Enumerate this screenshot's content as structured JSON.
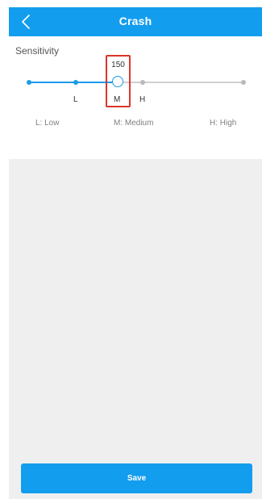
{
  "header": {
    "title": "Crash",
    "back_icon": "chevron-left-icon"
  },
  "sensitivity": {
    "label": "Sensitivity",
    "value": "150",
    "selected": "M",
    "levels": [
      "L",
      "M",
      "H"
    ],
    "legend": {
      "low": "L: Low",
      "medium": "M: Medium",
      "high": "H: High"
    }
  },
  "footer": {
    "save_label": "Save"
  },
  "colors": {
    "accent": "#139dee",
    "slider_active": "#1a9be8",
    "slider_inactive": "#cfcfcf",
    "highlight": "#d9362b",
    "content_bg": "#efefef"
  }
}
